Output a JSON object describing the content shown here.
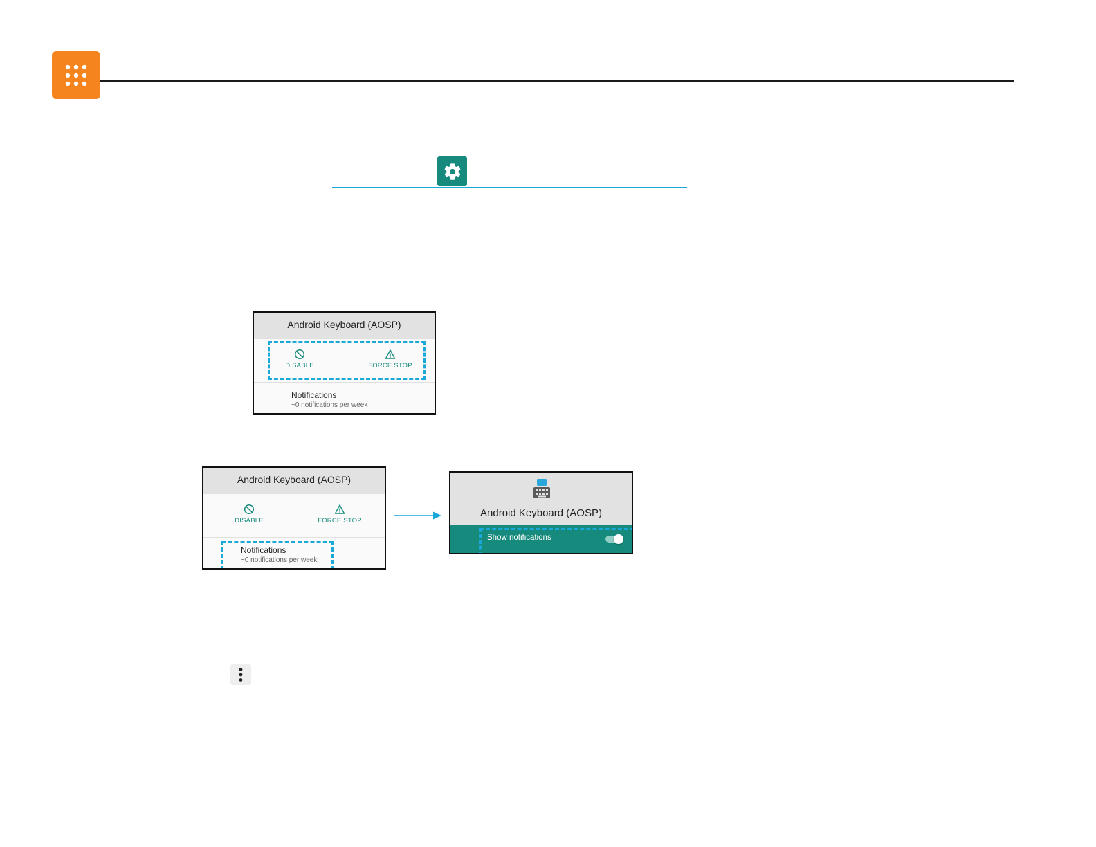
{
  "colors": {
    "header_accent": "#f5841f",
    "settings_accent": "#168a7c",
    "highlight": "#19a8d8",
    "app_action": "#168a7c"
  },
  "icons": {
    "header": "apps-grid-icon",
    "settings": "gear-icon",
    "disable": "disable-icon",
    "force_stop": "warning-icon",
    "keyboard": "keyboard-icon",
    "more": "more-vert-icon"
  },
  "screenshot1": {
    "title": "Android Keyboard (AOSP)",
    "disable_label": "DISABLE",
    "force_stop_label": "FORCE STOP",
    "notifications_title": "Notifications",
    "notifications_sub": "~0 notifications per week"
  },
  "screenshot2": {
    "title": "Android Keyboard (AOSP)",
    "disable_label": "DISABLE",
    "force_stop_label": "FORCE STOP",
    "notifications_title": "Notifications",
    "notifications_sub": "~0 notifications per week"
  },
  "screenshot3": {
    "title": "Android Keyboard (AOSP)",
    "show_notifications_label": "Show notifications",
    "show_notifications_enabled": true
  }
}
